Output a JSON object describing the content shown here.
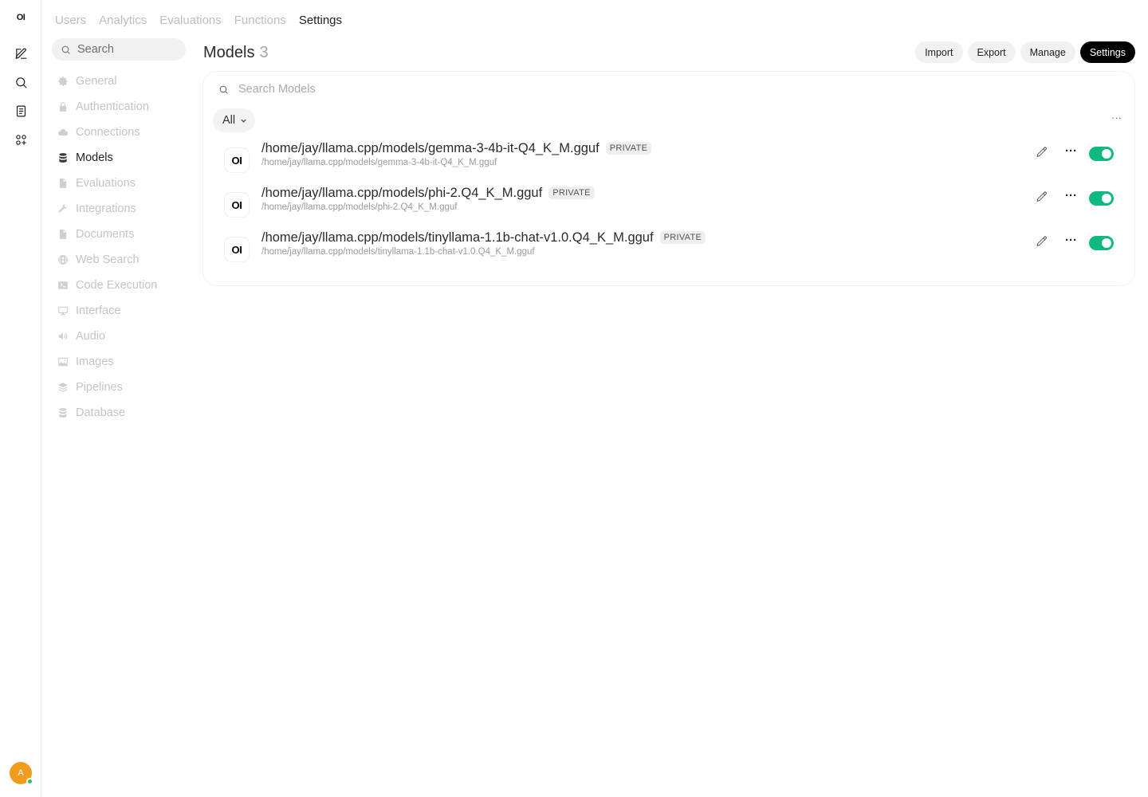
{
  "rail": {
    "logo": "OI",
    "avatar_initial": "A"
  },
  "top_tabs": [
    "Users",
    "Analytics",
    "Evaluations",
    "Functions",
    "Settings"
  ],
  "sidebar": {
    "search_placeholder": "Search",
    "items": [
      {
        "label": "General",
        "icon": "gear-icon"
      },
      {
        "label": "Authentication",
        "icon": "lock-icon"
      },
      {
        "label": "Connections",
        "icon": "cloud-icon"
      },
      {
        "label": "Models",
        "icon": "database-icon"
      },
      {
        "label": "Evaluations",
        "icon": "document-icon"
      },
      {
        "label": "Integrations",
        "icon": "wrench-icon"
      },
      {
        "label": "Documents",
        "icon": "document-icon"
      },
      {
        "label": "Web Search",
        "icon": "globe-icon"
      },
      {
        "label": "Code Execution",
        "icon": "terminal-icon"
      },
      {
        "label": "Interface",
        "icon": "monitor-icon"
      },
      {
        "label": "Audio",
        "icon": "speaker-icon"
      },
      {
        "label": "Images",
        "icon": "image-icon"
      },
      {
        "label": "Pipelines",
        "icon": "layers-icon"
      },
      {
        "label": "Database",
        "icon": "database-icon"
      }
    ]
  },
  "header": {
    "title": "Models",
    "count": "3",
    "buttons": {
      "import": "Import",
      "export": "Export",
      "manage": "Manage",
      "settings": "Settings"
    }
  },
  "card": {
    "search_placeholder": "Search Models",
    "filter_value": "All",
    "more_glyph": "···"
  },
  "models": [
    {
      "logo": "OI",
      "name": "/home/jay/llama.cpp/models/gemma-3-4b-it-Q4_K_M.gguf",
      "badge": "PRIVATE",
      "path": "/home/jay/llama.cpp/models/gemma-3-4b-it-Q4_K_M.gguf",
      "enabled": true
    },
    {
      "logo": "OI",
      "name": "/home/jay/llama.cpp/models/phi-2.Q4_K_M.gguf",
      "badge": "PRIVATE",
      "path": "/home/jay/llama.cpp/models/phi-2.Q4_K_M.gguf",
      "enabled": true
    },
    {
      "logo": "OI",
      "name": "/home/jay/llama.cpp/models/tinyllama-1.1b-chat-v1.0.Q4_K_M.gguf",
      "badge": "PRIVATE",
      "path": "/home/jay/llama.cpp/models/tinyllama-1.1b-chat-v1.0.Q4_K_M.gguf",
      "enabled": true
    }
  ],
  "row_more_glyph": "···",
  "colors": {
    "toggle_on": "#10b981",
    "avatar": "#f29b1d",
    "online_dot": "#22c55e",
    "settings_button": "#000000"
  }
}
